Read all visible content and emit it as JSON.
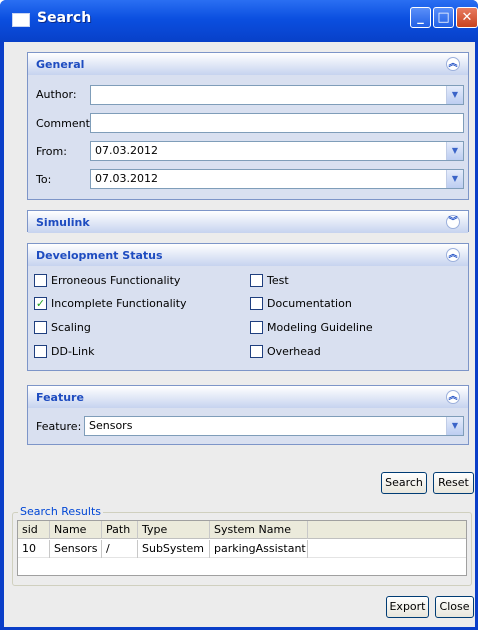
{
  "window": {
    "title": "Search",
    "controls": {
      "minimize": "_",
      "maximize": "□",
      "close": "✕"
    }
  },
  "general": {
    "title": "General",
    "author_label": "Author:",
    "author_value": "",
    "comment_label": "Comment:",
    "comment_value": "",
    "from_label": "From:",
    "from_value": "07.03.2012",
    "to_label": "To:",
    "to_value": "07.03.2012"
  },
  "simulink": {
    "title": "Simulink"
  },
  "development_status": {
    "title": "Development Status",
    "options": [
      {
        "label": "Erroneous Functionality",
        "checked": false
      },
      {
        "label": "Test",
        "checked": false
      },
      {
        "label": "Incomplete Functionality",
        "checked": true
      },
      {
        "label": "Documentation",
        "checked": false
      },
      {
        "label": "Scaling",
        "checked": false
      },
      {
        "label": "Modeling Guideline",
        "checked": false
      },
      {
        "label": "DD-Link",
        "checked": false
      },
      {
        "label": "Overhead",
        "checked": false
      }
    ]
  },
  "feature": {
    "title": "Feature",
    "feature_label": "Feature:",
    "feature_value": "Sensors"
  },
  "actions": {
    "search": "Search",
    "reset": "Reset",
    "export": "Export",
    "close": "Close"
  },
  "results": {
    "title": "Search Results",
    "columns": [
      "sid",
      "Name",
      "Path",
      "Type",
      "System Name"
    ],
    "rows": [
      [
        "10",
        "Sensors",
        "/",
        "SubSystem",
        "parkingAssistant"
      ]
    ]
  },
  "icons": {
    "expanded": "collapse-chevron-up-icon",
    "collapsed": "expand-chevron-down-icon",
    "dropdown": "chevron-down-icon",
    "check": "checkmark-icon"
  },
  "colors": {
    "titlebar": "#0b4fe0",
    "panel_header_text": "#1e4cc0",
    "panel_bg": "#d9e0f0",
    "check": "#21a121"
  }
}
